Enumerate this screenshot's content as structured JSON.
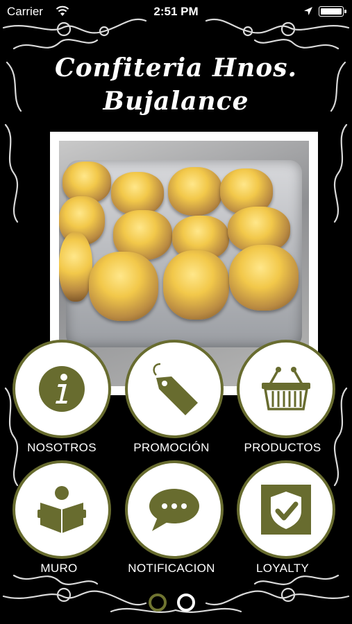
{
  "status_bar": {
    "carrier": "Carrier",
    "time": "2:51 PM",
    "wifi_icon": "wifi-icon",
    "location_icon": "location-arrow-icon",
    "battery_level": 1.0
  },
  "header": {
    "title_line1": "Confiteria Hnos.",
    "title_line2": "Bujalance"
  },
  "photo": {
    "description_icon": "photo-pastries"
  },
  "menu": [
    {
      "label": "NOSOTROS",
      "icon": "info-icon"
    },
    {
      "label": "PROMOCIÓN",
      "icon": "price-tag-icon"
    },
    {
      "label": "PRODUCTOS",
      "icon": "shopping-basket-icon"
    },
    {
      "label": "MURO",
      "icon": "reading-person-icon"
    },
    {
      "label": "NOTIFICACION",
      "icon": "chat-bubble-icon"
    },
    {
      "label": "LOYALTY",
      "icon": "shield-check-icon"
    }
  ],
  "pager": {
    "pages": 2,
    "current": 1
  },
  "colors": {
    "accent": "#686c2f",
    "background": "#000000",
    "button_fill": "#ffffff"
  }
}
